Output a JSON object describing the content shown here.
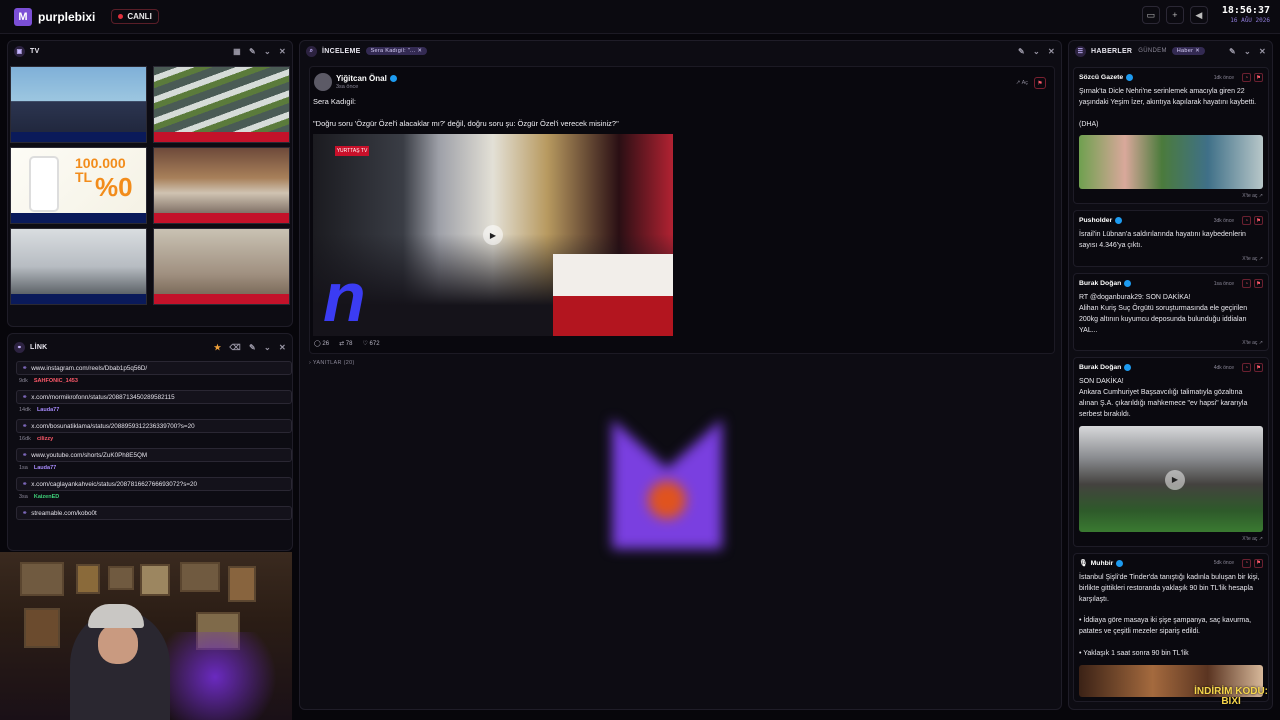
{
  "app": {
    "name": "purplebixi",
    "live_label": "CANLI",
    "time": "18:56:37",
    "date": "16 AĞU 2026"
  },
  "tv": {
    "title": "TV"
  },
  "links": {
    "title": "LİNK",
    "items": [
      {
        "url": "www.instagram.com/reels/Dbab1p5q56D/",
        "ago": "9dk",
        "user": "SAHFONIC_1453",
        "color": "#ff5a6a"
      },
      {
        "url": "x.com/mormikrofonn/status/2088713450289582115",
        "ago": "14dk",
        "user": "Lauda77",
        "color": "#a98cff"
      },
      {
        "url": "x.com/bosunatiklama/status/20889593122363397​00?s=20",
        "ago": "16dk",
        "user": "cilizzy",
        "color": "#ff5a6a"
      },
      {
        "url": "www.youtube.com/shorts/ZuK0Ph8E5QM",
        "ago": "1sa",
        "user": "Lauda77",
        "color": "#a98cff"
      },
      {
        "url": "x.com/caglayankahveic/status/20878166276669307​2?s=20",
        "ago": "3sa",
        "user": "KaizenED",
        "color": "#3fd37a"
      },
      {
        "url": "streamable.com/kobo0t",
        "ago": "",
        "user": "",
        "color": "#a98cff"
      }
    ]
  },
  "inceleme": {
    "title": "İNCELEME",
    "chip": "Sera Kadıgil: \"...",
    "tweet": {
      "author": "Yiğitcan Önal",
      "ago": "3sa önce",
      "open": "Aç",
      "text": "Sera Kadıgil:\n\n\"Doğru soru 'Özgür Özel'i alacaklar mı?' değil, doğru soru şu: Özgür Özel'i verecek misiniz?\"",
      "logo": "YURTTAŞ TV",
      "replies": "26",
      "retweets": "78",
      "likes": "672"
    },
    "replies_label": "YANITLAR (20)"
  },
  "haberler": {
    "title": "HABERLER",
    "tab2": "GÜNDEM",
    "chip": "Haber",
    "open_label": "X'te aç",
    "items": [
      {
        "source": "Sözcü Gazete",
        "ago": "1dk önce",
        "text": "Şırnak'ta Dicle Nehri'ne serinlemek amacıyla giren 22 yaşındaki Yeşim İzer, akıntıya kapılarak hayatını kaybetti.\n\n(DHA)"
      },
      {
        "source": "Pusholder",
        "ago": "3dk önce",
        "text": "İsrail'in Lübnan'a saldırılarında hayatını kaybedenlerin sayısı 4.346'ya çıktı."
      },
      {
        "source": "Burak Doğan",
        "ago": "1sa önce",
        "text": "RT @doganburak29: SON DAKİKA!\nAlihan Kuriş Suç Örgütü soruşturmasında ele geçirilen 200kg altının kuyumcu deposunda bulunduğu iddiaları YAL..."
      },
      {
        "source": "Burak Doğan",
        "ago": "4dk önce",
        "text": "SON DAKİKA!\nAnkara Cumhuriyet Başsavcılığı talimatıyla gözaltına alınan Ş.A. çıkarıldığı mahkemece \"ev hapsi\" kararıyla serbest bırakıldı."
      },
      {
        "source": "Muhbir",
        "ago": "5dk önce",
        "text": "İstanbul Şişli'de Tinder'da tanıştığı kadınla buluşan bir kişi, birlikte gittikleri restoranda yaklaşık 90 bin TL'lik hesapla karşılaştı.\n\n• İddiaya göre masaya iki şişe şampanya, saç kavurma, patates ve çeşitli mezeler sipariş edildi.\n\n• Yaklaşık 1 saat sonra 90 bin TL'lik"
      }
    ]
  },
  "promo": {
    "line1": "İNDİRİM KODU:",
    "line2": "BIXI"
  },
  "tv_promo": {
    "amount": "100.000 TL",
    "zero": "%0"
  }
}
